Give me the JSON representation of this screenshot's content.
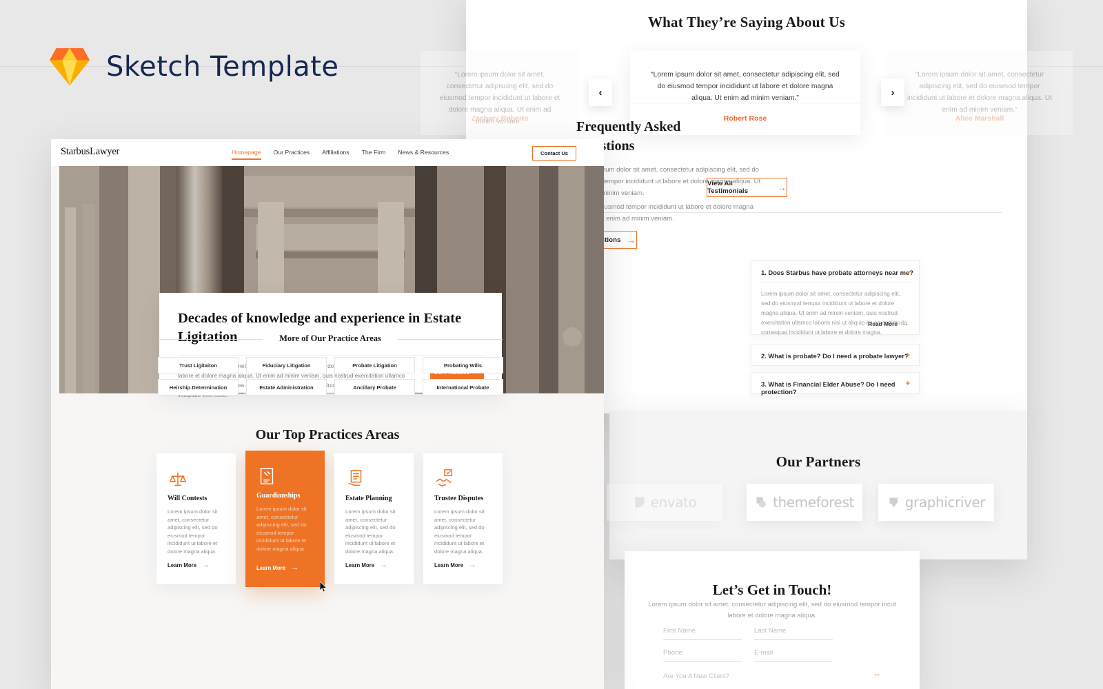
{
  "page": {
    "brand_title": "Sketch Template",
    "brand_icon": "sketch-diamond-icon",
    "background": "#e8e8e8",
    "accent": "#ee7325"
  },
  "site": {
    "logo": "StarbusLawyer",
    "nav": [
      {
        "label": "Homepage",
        "active": true
      },
      {
        "label": "Our Practices",
        "active": false
      },
      {
        "label": "Affiliations",
        "active": false
      },
      {
        "label": "The Firm",
        "active": false
      },
      {
        "label": "News & Resources",
        "active": false
      }
    ],
    "contact_button": "Contact Us"
  },
  "hero": {
    "heading": "Decades of knowledge and experience in Estate Ligitation",
    "paragraph": "Lorem ipsum dolor sit amet, consectetur adipiscing elit, sed do eiusmod tempor incididunt ut labore et dolore magna aliqua. Ut enim ad minim veniam, quis nostrud exercitation ullamco laboris nisi ut aliquip ex ea commodo consequat. Duis aute irure dolor in reprehenderit in voluptate velit esse.",
    "button": "Our Practices",
    "arrow": "→"
  },
  "practices": {
    "title": "Our Top Practices Areas",
    "learn_more": "Learn More",
    "arrow": "→",
    "cards": [
      {
        "icon": "scales-gavel-icon",
        "title": "Will Contests",
        "body": "Lorem ipsum dolor sit amet, consectetur adipiscing elit, sed do eiusmod tempor incididunt ut labore et dolore magna aliqua.",
        "active": false
      },
      {
        "icon": "document-gavel-icon",
        "title": "Guardianships",
        "body": "Lorem ipsum dolor sit amet, consectetur adipiscing elit, sed do eiusmod tempor incididunt ut labore et dolore magna aliqua.",
        "active": true
      },
      {
        "icon": "document-hand-icon",
        "title": "Estate Planning",
        "body": "Lorem ipsum dolor sit amet, consectetur adipiscing elit, sed do eiusmod tempor incididunt ut labore et dolore magna aliqua.",
        "active": false
      },
      {
        "icon": "handshake-check-icon",
        "title": "Trustee Disputes",
        "body": "Lorem ipsum dolor sit amet, consectetur adipiscing elit, sed do eiusmod tempor incididunt ut labore et dolore magna aliqua.",
        "active": false
      }
    ]
  },
  "more_practices": {
    "label": "More of Our Practice Areas",
    "chips": [
      "Trust Ligitaiton",
      "Fiduciary Litigation",
      "Probate Litigation",
      "Probating Wills",
      "Heirship Determination",
      "Estate Administration",
      "Ancillary Probate",
      "International Probate"
    ]
  },
  "testimonials": {
    "title": "What They’re Saying About Us",
    "prev_icon": "chevron-left-icon",
    "next_icon": "chevron-right-icon",
    "prev_glyph": "‹",
    "next_glyph": "›",
    "view_all": "View All Testimonials",
    "arrow": "→",
    "items": [
      {
        "quote": "“Lorem ipsum dolor sit amet, consectetur adipiscing elit, sed do eiusmod tempor incididunt ut labore et dolore magna aliqua. Ut enim ad minim veniam.”",
        "author": "Zachary Roberts",
        "state": "faded"
      },
      {
        "quote": "“Lorem ipsum dolor sit amet, consectetur adipiscing elit, sed do eiusmod tempor incididunt ut labore et dolore magna aliqua. Ut enim ad minim veniam.”",
        "author": "Robert Rose",
        "state": "active"
      },
      {
        "quote": "“Lorem ipsum dolor sit amet, consectetur adipiscing elit, sed do eiusmod tempor incididunt ut labore et dolore magna aliqua. Ut enim ad minim veniam.”",
        "author": "Alice Marshall",
        "state": "faded"
      }
    ]
  },
  "faq": {
    "heading_line1": "Frequently Asked",
    "heading_line2": "Questions",
    "paragraph_1": "Lorem ipsum dolor sit amet, consectetur adipiscing elit, sed do eiusmod tempor incididunt ut labore et dolore magna aliqua. Ut enim ad minim veniam.",
    "paragraph_2": "Sed do eiusmod tempor incididunt ut labore et dolore magna aliqua. Ut enim ad minim veniam.",
    "button": "All Questions",
    "arrow": "→",
    "read_more": "Read More",
    "items": [
      {
        "question": "1. Does Starbus have probate attorneys near me?",
        "sign": "–",
        "open": true,
        "answer": "Lorem ipsum dolor sit amet, consectetur adipiscing elit, sed do eiusmod tempor incididunt ut labore et dolore magna aliqua. Ut enim ad minim veniam, quis nostrud exercitation ullamco laboris nisi ut aliquip ex ea commodo consequat incididunt ut labore et dolore magna."
      },
      {
        "question": "2. What is probate? Do I need a probate lawyer?",
        "sign": "+",
        "open": false,
        "answer": ""
      },
      {
        "question": "3. What is Financial Elder Abuse? Do I need protection?",
        "sign": "+",
        "open": false,
        "answer": ""
      }
    ]
  },
  "partners": {
    "title": "Our Partners",
    "logos": [
      {
        "name": "envato",
        "icon": "envato-logo-icon",
        "faded": true
      },
      {
        "name": "themeforest",
        "icon": "themeforest-logo-icon",
        "faded": false
      },
      {
        "name": "graphicriver",
        "icon": "graphicriver-logo-icon",
        "faded": false
      }
    ]
  },
  "contact": {
    "title": "Let’s Get in Touch!",
    "subtitle": "Lorem ipsum dolor sit amet, consectetur adipiscing elit, sed do eiusmod tempor incut labore et dolore magna aliqua.",
    "fields": [
      {
        "placeholder": "First Name"
      },
      {
        "placeholder": "Last Name"
      },
      {
        "placeholder": "Phone"
      },
      {
        "placeholder": "E-mail"
      }
    ],
    "question": "Are You A New Client?"
  }
}
